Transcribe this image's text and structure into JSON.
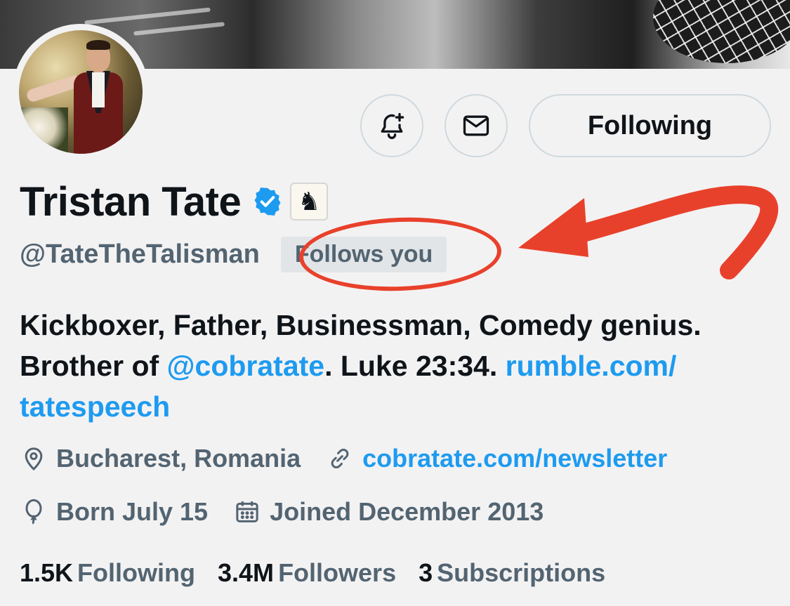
{
  "profile": {
    "name": "Tristan Tate",
    "handle": "@TateTheTalisman",
    "follows_you": "Follows you",
    "affiliate_icon": "chess-knight-icon",
    "verified_color": "#1d9bf0",
    "bio": {
      "part1": "Kickboxer, Father, Businessman, Comedy genius.",
      "brother_prefix": "Brother of ",
      "mention": "@cobratate",
      "after_mention": ". Luke 23:34. ",
      "link1": "rumble.com/",
      "link2": "tatespeech"
    },
    "location": "Bucharest, Romania",
    "website": "cobratate.com/newsletter",
    "born": "Born July 15",
    "joined": "Joined December 2013"
  },
  "actions": {
    "notify_icon": "bell-plus-icon",
    "message_icon": "envelope-icon",
    "follow_label": "Following"
  },
  "stats": [
    {
      "count": "1.5K",
      "label": "Following"
    },
    {
      "count": "3.4M",
      "label": "Followers"
    },
    {
      "count": "3",
      "label": "Subscriptions"
    }
  ],
  "colors": {
    "accent": "#1d9bf0",
    "annotation": "#e8412b",
    "secondary_text": "#536471"
  }
}
